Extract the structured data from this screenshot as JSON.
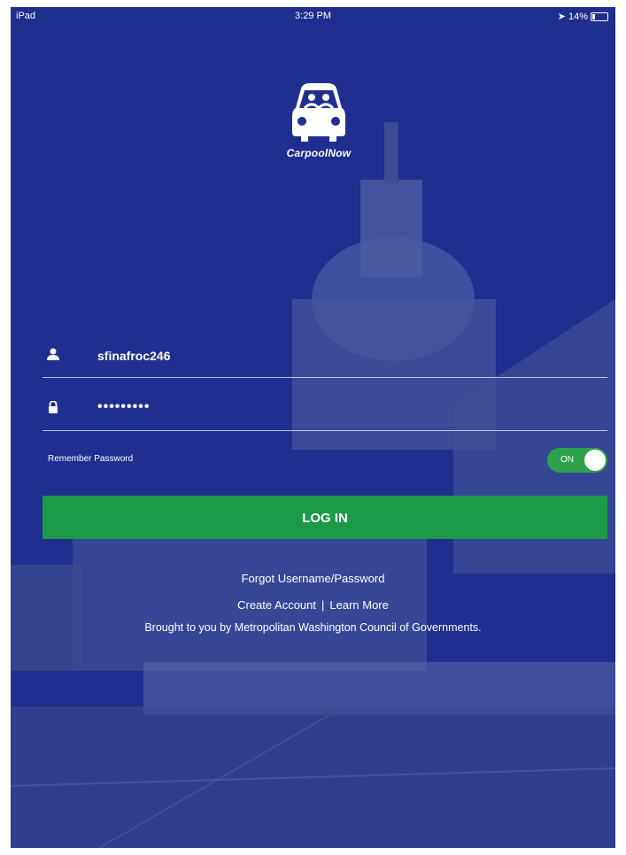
{
  "status_bar": {
    "device": "iPad",
    "time": "3:29 PM",
    "battery": "14%"
  },
  "app": {
    "name": "CarpoolNow"
  },
  "login": {
    "username_value": "sfinafroc246",
    "password_value": "•••••••••",
    "remember_label": "Remember Password",
    "remember_toggle_label": "ON",
    "remember_enabled": true,
    "login_button_label": "LOG IN"
  },
  "links": {
    "forgot": "Forgot Username/Password",
    "create_account": "Create Account",
    "separator": "|",
    "learn_more": "Learn More",
    "brought_by": "Brought to you by Metropolitan Washington Council of Governments."
  },
  "colors": {
    "overlay_blue": "#1f2f8f",
    "primary_green": "#1b9a47",
    "toggle_green": "#2ea24a"
  }
}
